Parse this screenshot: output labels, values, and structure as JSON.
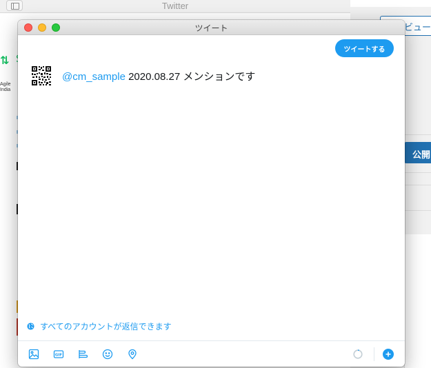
{
  "background": {
    "window_title": "Twitter",
    "retweet_glyph": "⇅",
    "retweet_label": "S",
    "agile_logo_lines": [
      "Agile",
      "India"
    ],
    "preview_button": "ビュー",
    "publish_button": "公開"
  },
  "compose": {
    "window_title": "ツイート",
    "send_button": "ツイートする",
    "avatar_icon": "qr-code-avatar-icon",
    "mention": "@cm_sample",
    "body": " 2020.08.27 メンションです",
    "reply_setting": "すべてのアカウントが返信できます",
    "accent_color": "#1d9bf0",
    "toolbar_icons": [
      "image-icon",
      "gif-icon",
      "poll-icon",
      "emoji-icon",
      "location-icon"
    ]
  }
}
